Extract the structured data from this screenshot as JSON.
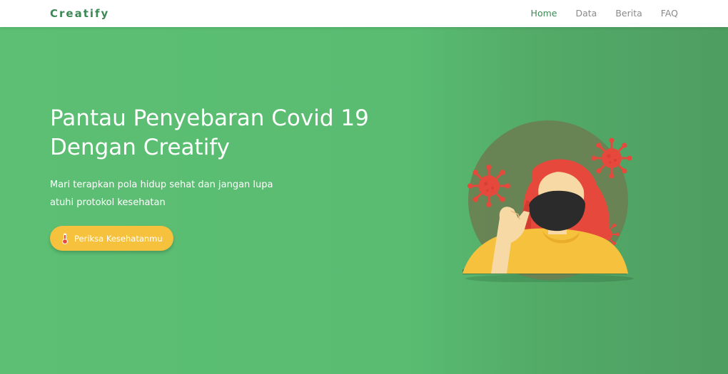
{
  "brand": "Creatify",
  "nav": {
    "items": [
      {
        "label": "Home",
        "active": true
      },
      {
        "label": "Data",
        "active": false
      },
      {
        "label": "Berita",
        "active": false
      },
      {
        "label": "FAQ",
        "active": false
      }
    ]
  },
  "hero": {
    "title_line1": "Pantau Penyebaran Covid 19",
    "title_line2": "Dengan Creatify",
    "text_line1": "Mari terapkan pola hidup sehat dan jangan lupa",
    "text_line2": "atuhi protokol kesehatan",
    "cta_label": "Periksa Kesehatanmu",
    "cta_icon": "thermometer-icon"
  },
  "colors": {
    "primary_green": "#5bbd72",
    "brand_green": "#3b8a55",
    "button_yellow": "#f6c13d",
    "virus_red": "#e6483c"
  },
  "illustration": {
    "icon": "masked-woman-virus-illustration"
  }
}
